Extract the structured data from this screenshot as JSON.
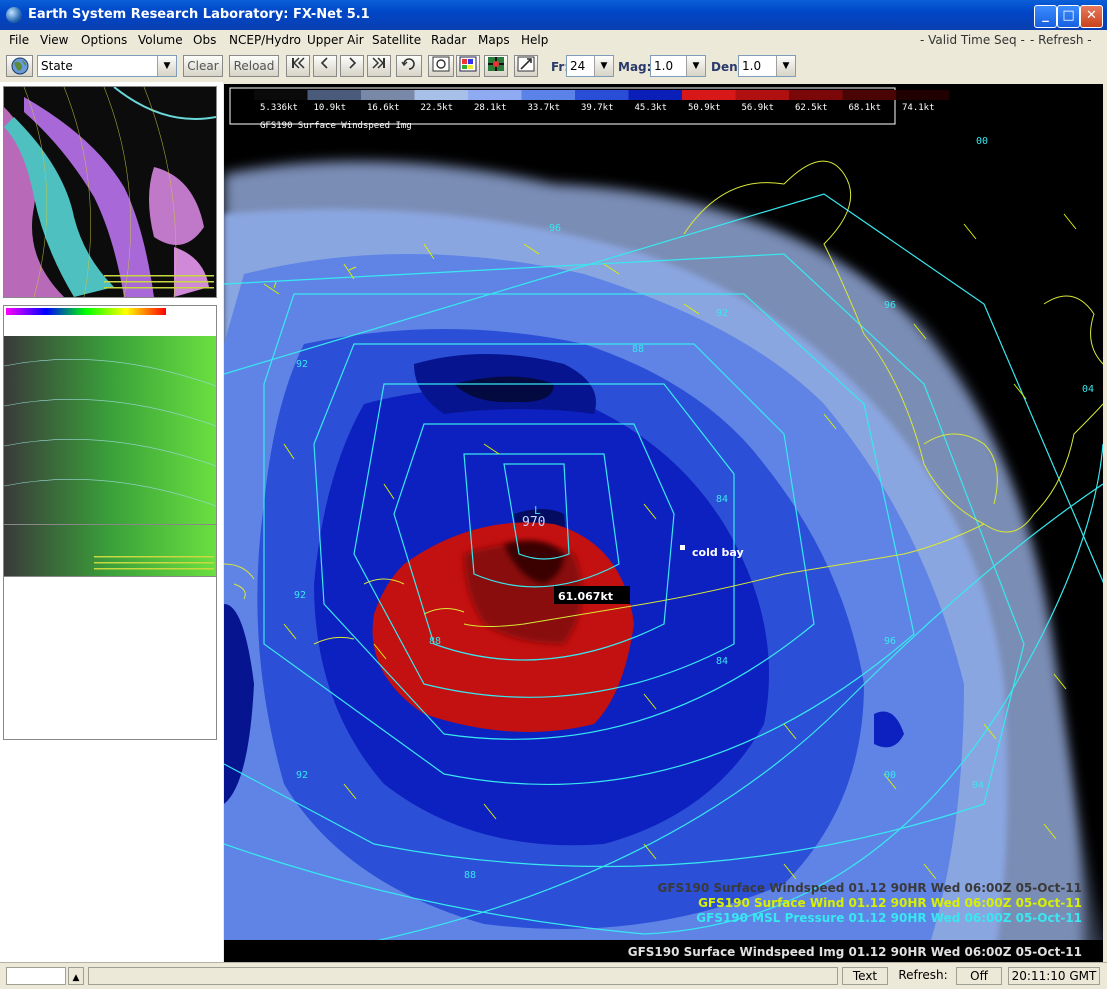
{
  "window": {
    "title": "Earth System Research Laboratory: FX-Net 5.1",
    "minimize": "_",
    "maximize": "□",
    "close": "✕"
  },
  "menu": {
    "items": [
      "File",
      "View",
      "Options",
      "Volume",
      "Obs",
      "NCEP/Hydro",
      "Upper Air",
      "Satellite",
      "Radar",
      "Maps",
      "Help"
    ],
    "valid_time_seq": "- Valid Time Seq -",
    "refresh": "- Refresh -"
  },
  "toolbar": {
    "scale_select": "State",
    "clear_label": "Clear",
    "reload_label": "Reload",
    "icons": [
      "globe-icon",
      "first-frame-icon",
      "prev-frame-icon",
      "next-frame-icon",
      "last-frame-icon",
      "loop-icon",
      "loop-toggle-icon",
      "image-palette-icon",
      "sample-icon",
      "zoom-icon"
    ],
    "fr_label": "Fr:",
    "fr_value": "24",
    "mag_label": "Mag:",
    "mag_value": "1.0",
    "den_label": "Den:",
    "den_value": "1.0"
  },
  "colorbar": {
    "ticks": [
      "5.336kt",
      "10.9kt",
      "16.6kt",
      "22.5kt",
      "28.1kt",
      "33.7kt",
      "39.7kt",
      "45.3kt",
      "50.9kt",
      "56.9kt",
      "62.5kt",
      "68.1kt",
      "74.1kt"
    ],
    "caption": "GFS190 Surface Windspeed Img",
    "colors": [
      "#0a0a0a",
      "#4a5a7a",
      "#7a88a8",
      "#a8bfe8",
      "#8eaaf0",
      "#5b82e8",
      "#2a4dd8",
      "#0a1fb8",
      "#d81818",
      "#b01010",
      "#7a0808",
      "#4a0404",
      "#200000"
    ]
  },
  "map": {
    "low_center_label": "970",
    "low_marker": "L",
    "sample_readout": "61.067kt",
    "station_label": "cold bay",
    "isobar_labels": [
      "96",
      "92",
      "88",
      "84",
      "88",
      "92",
      "96",
      "00",
      "04",
      "92",
      "88",
      "84",
      "96",
      "92",
      "04",
      "00",
      "96",
      "00"
    ],
    "legend": [
      {
        "text": "GFS190 Surface Windspeed 01.12  90HR Wed 06:00Z 05-Oct-11",
        "color": "#3a3a3a"
      },
      {
        "text": "GFS190 Surface Wind  01.12  90HR Wed 06:00Z 05-Oct-11",
        "color": "#d8f000"
      },
      {
        "text": "GFS190 MSL Pressure  01.12  90HR Wed 06:00Z 05-Oct-11",
        "color": "#38e8f0"
      }
    ],
    "bottom_label": "GFS190 Surface Windspeed Img 01.12  90HR Wed 06:00Z 05-Oct-11"
  },
  "status": {
    "text_label": "Text",
    "refresh_label": "Refresh:",
    "refresh_value": "Off",
    "time": "20:11:10 GMT"
  }
}
